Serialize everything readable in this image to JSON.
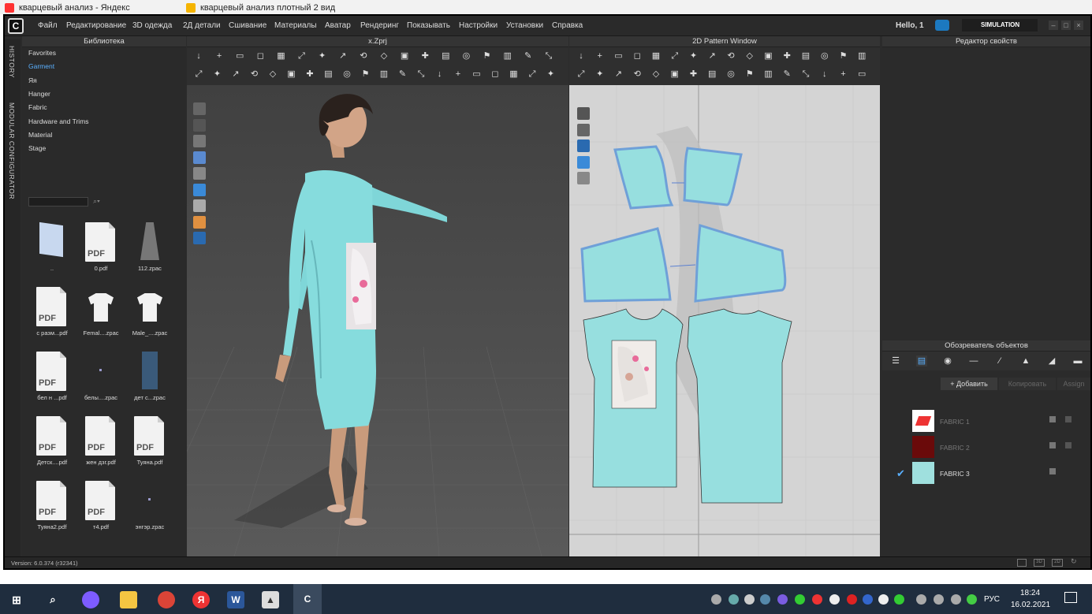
{
  "browser": {
    "tabs": [
      "кварцевый анализ - Яндекс",
      "кварцевый анализ плотный 2 вид"
    ]
  },
  "menubar": {
    "items": [
      "Файл",
      "Редактирование",
      "3D одежда",
      "2Д детали",
      "Сшивание",
      "Материалы",
      "Аватар",
      "Рендеринг",
      "Показывать",
      "Настройки",
      "Установки",
      "Справка"
    ],
    "hello": "Hello, 1",
    "simulation": "SIMULATION"
  },
  "side_tabs": [
    "HISTORY",
    "MODULAR CONFIGURATOR"
  ],
  "library": {
    "title": "Библиотека",
    "categories": [
      "Favorites",
      "Garment",
      "Яя",
      "Hanger",
      "Fabric",
      "Hardware and Trims",
      "Material",
      "Stage"
    ],
    "files": [
      {
        "label": "..",
        "kind": "folder"
      },
      {
        "label": "0.pdf",
        "kind": "pdf"
      },
      {
        "label": "112.zpac",
        "kind": "dress"
      },
      {
        "label": "с разм...pdf",
        "kind": "pdf"
      },
      {
        "label": "Femal....zpac",
        "kind": "tshirt"
      },
      {
        "label": "Male_....zpac",
        "kind": "tshirt"
      },
      {
        "label": "бел н ...pdf",
        "kind": "pdf"
      },
      {
        "label": "белы....zpac",
        "kind": "dot"
      },
      {
        "label": "дет с...zpac",
        "kind": "kimono"
      },
      {
        "label": "Детск....pdf",
        "kind": "pdf"
      },
      {
        "label": "жен дзг.pdf",
        "kind": "pdf"
      },
      {
        "label": "Туяна.pdf",
        "kind": "pdf"
      },
      {
        "label": "Туяна2.pdf",
        "kind": "pdf"
      },
      {
        "label": "т4.pdf",
        "kind": "pdf"
      },
      {
        "label": "энгэр.zpac",
        "kind": "dot"
      }
    ],
    "pdf_text": "PDF"
  },
  "view3d": {
    "title": "x.Zprj"
  },
  "view2d": {
    "title": "2D Pattern Window"
  },
  "props": {
    "title": "Редактор свойств"
  },
  "objbrowser": {
    "title": "Обозреватель объектов",
    "add": "+ Добавить",
    "copy": "Копировать",
    "assign": "Assign",
    "fabrics": [
      {
        "name": "FABRIC 1",
        "color": "#ffffff",
        "active": false
      },
      {
        "name": "FABRIC 2",
        "color": "#6a0a0a",
        "active": false
      },
      {
        "name": "FABRIC 3",
        "color": "#9fe0de",
        "active": true
      }
    ]
  },
  "status": {
    "version": "Version: 6.0.374 (r32341)"
  },
  "taskbar": {
    "lang": "РУС",
    "time": "18:24",
    "date": "16.02.2021"
  }
}
